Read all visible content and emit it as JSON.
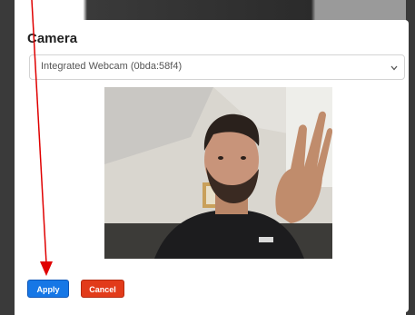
{
  "dialog": {
    "title": "Camera",
    "camera_select": {
      "value": "Integrated Webcam (0bda:58f4)"
    },
    "buttons": {
      "apply": "Apply",
      "cancel": "Cancel"
    }
  },
  "colors": {
    "apply": "#1677e6",
    "cancel": "#e23b1a",
    "annotation_arrow": "#e00000"
  },
  "icons": {
    "select_chevron": "chevron-down-icon",
    "annotation": "red-arrow-annotation"
  }
}
